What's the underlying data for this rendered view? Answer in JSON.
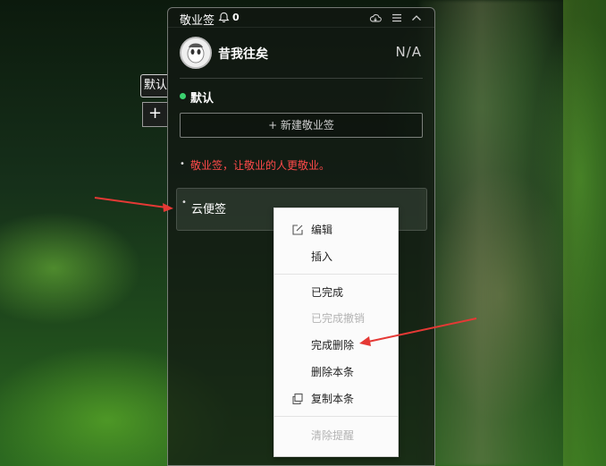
{
  "app": {
    "title": "敬业签",
    "bell_count": "0"
  },
  "side": {
    "tab_label": "默认",
    "add_label": "+"
  },
  "user": {
    "name": "昔我往矣",
    "status": "N/A"
  },
  "category": {
    "name": "默认",
    "dot_color": "#3bd16f"
  },
  "new_note_button": "+ 新建敬业签",
  "notes": [
    {
      "text": "敬业签，让敬业的人更敬业。",
      "color": "#ff4a4a"
    },
    {
      "text": "云便签"
    }
  ],
  "context_menu": {
    "items": [
      {
        "label": "编辑",
        "icon": "edit-icon",
        "enabled": true
      },
      {
        "label": "插入",
        "enabled": true
      },
      {
        "label": "已完成",
        "enabled": true
      },
      {
        "label": "已完成撤销",
        "enabled": false
      },
      {
        "label": "完成删除",
        "enabled": true
      },
      {
        "label": "删除本条",
        "enabled": true
      },
      {
        "label": "复制本条",
        "icon": "copy-icon",
        "enabled": true
      },
      {
        "label": "清除提醒",
        "enabled": false
      }
    ]
  },
  "annotation_color": "#e53935"
}
